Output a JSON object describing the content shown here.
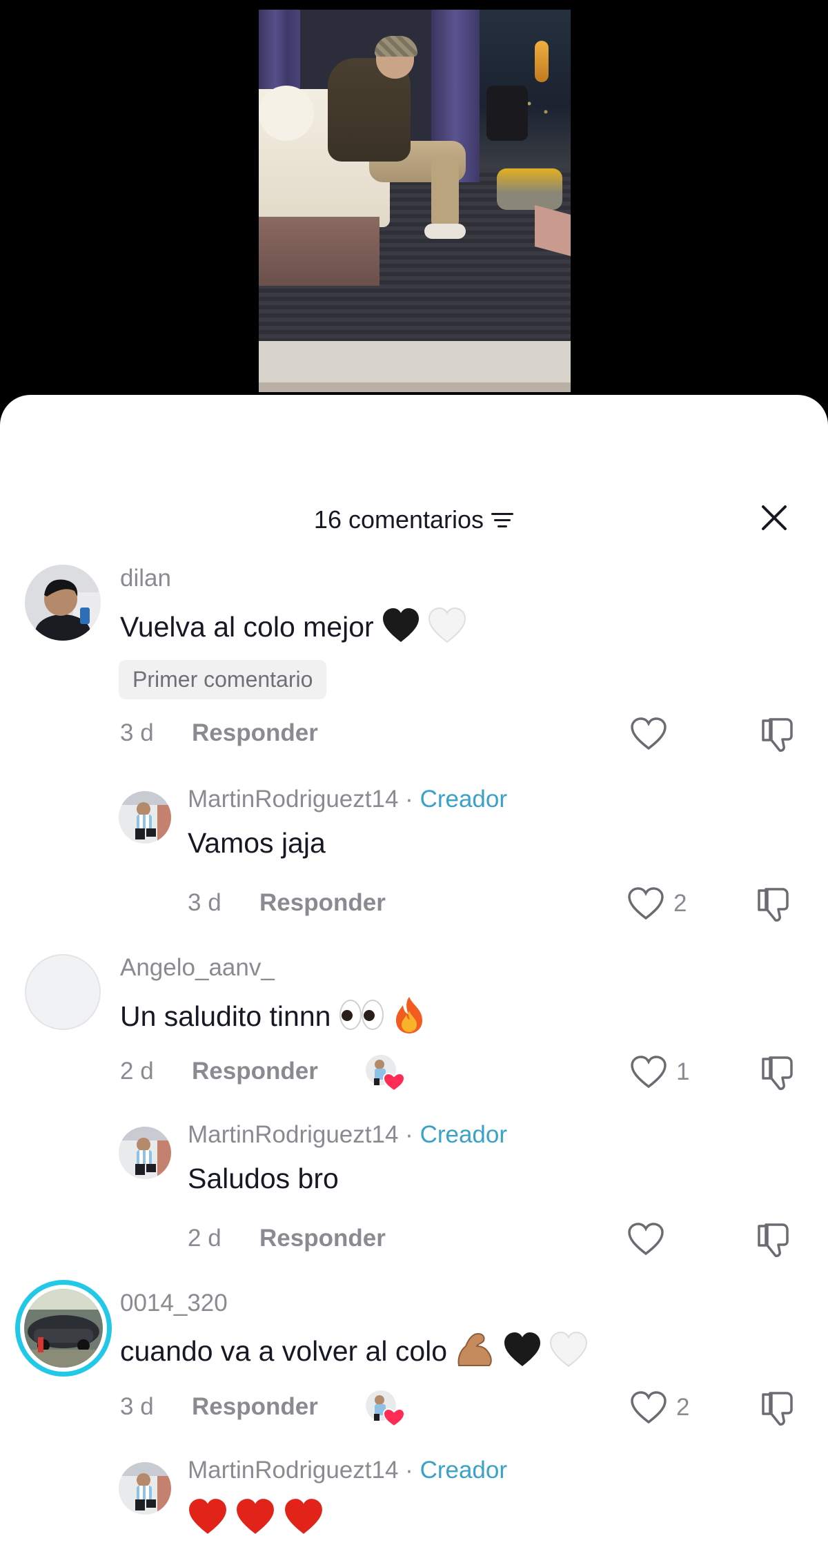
{
  "header": {
    "comment_count": "16 comentarios"
  },
  "comments": [
    {
      "username": "dilan",
      "text": "Vuelva al colo mejor",
      "badge": "Primer comentario",
      "time": "3 d",
      "reply_label": "Responder",
      "likes": "",
      "replies": [
        {
          "username": "MartinRodriguezt14",
          "creator_label": "Creador",
          "text": "Vamos jaja",
          "time": "3 d",
          "reply_label": "Responder",
          "likes": "2"
        }
      ]
    },
    {
      "username": "Angelo_aanv_",
      "text": "Un saludito tinnn",
      "time": "2 d",
      "reply_label": "Responder",
      "likes": "1",
      "replies": [
        {
          "username": "MartinRodriguezt14",
          "creator_label": "Creador",
          "text": "Saludos bro",
          "time": "2 d",
          "reply_label": "Responder",
          "likes": ""
        }
      ]
    },
    {
      "username": "0014_320",
      "text": "cuando va a volver al colo",
      "time": "3 d",
      "reply_label": "Responder",
      "likes": "2",
      "replies": [
        {
          "username": "MartinRodriguezt14",
          "creator_label": "Creador",
          "text": ""
        }
      ]
    }
  ],
  "separator": "·",
  "colors": {
    "creator": "#3aa2c9",
    "text": "#161823",
    "muted": "#8a8b91",
    "story_ring": "#22c8e8"
  },
  "icons": {
    "sort": "sort-lines-icon",
    "close": "close-x-icon",
    "like": "heart-outline-icon",
    "dislike": "thumbs-down-icon",
    "creator_liked": "creator-liked-heart-icon"
  }
}
